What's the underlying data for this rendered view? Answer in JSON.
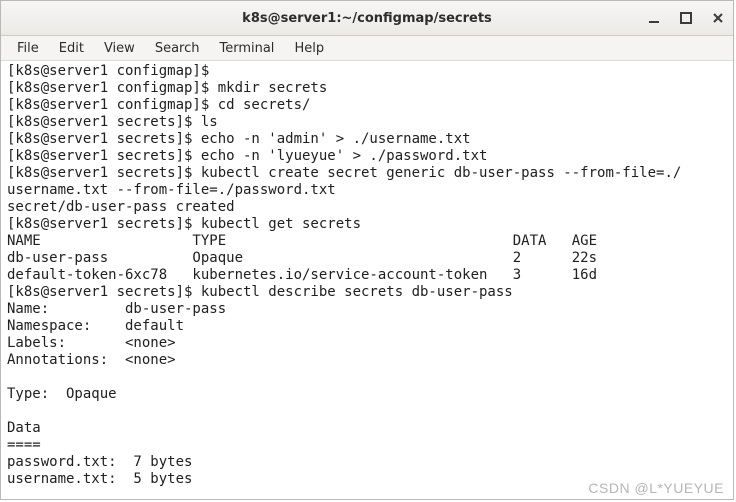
{
  "window": {
    "title": "k8s@server1:~/configmap/secrets"
  },
  "menu": {
    "file": "File",
    "edit": "Edit",
    "view": "View",
    "search": "Search",
    "terminal": "Terminal",
    "help": "Help"
  },
  "terminal_lines": {
    "l00": "[k8s@server1 configmap]$ ",
    "l01": "[k8s@server1 configmap]$ mkdir secrets",
    "l02": "[k8s@server1 configmap]$ cd secrets/",
    "l03": "[k8s@server1 secrets]$ ls",
    "l04": "[k8s@server1 secrets]$ echo -n 'admin' > ./username.txt",
    "l05": "[k8s@server1 secrets]$ echo -n 'lyueyue' > ./password.txt",
    "l06": "[k8s@server1 secrets]$ kubectl create secret generic db-user-pass --from-file=./",
    "l07": "username.txt --from-file=./password.txt",
    "l08": "secret/db-user-pass created",
    "l09": "[k8s@server1 secrets]$ kubectl get secrets",
    "l10": "NAME                  TYPE                                  DATA   AGE",
    "l11": "db-user-pass          Opaque                                2      22s",
    "l12": "default-token-6xc78   kubernetes.io/service-account-token   3      16d",
    "l13": "[k8s@server1 secrets]$ kubectl describe secrets db-user-pass",
    "l14": "Name:         db-user-pass",
    "l15": "Namespace:    default",
    "l16": "Labels:       <none>",
    "l17": "Annotations:  <none>",
    "l18": "",
    "l19": "Type:  Opaque",
    "l20": "",
    "l21": "Data",
    "l22": "====",
    "l23": "password.txt:  7 bytes",
    "l24": "username.txt:  5 bytes"
  },
  "watermark": "CSDN @L*YUEYUE"
}
